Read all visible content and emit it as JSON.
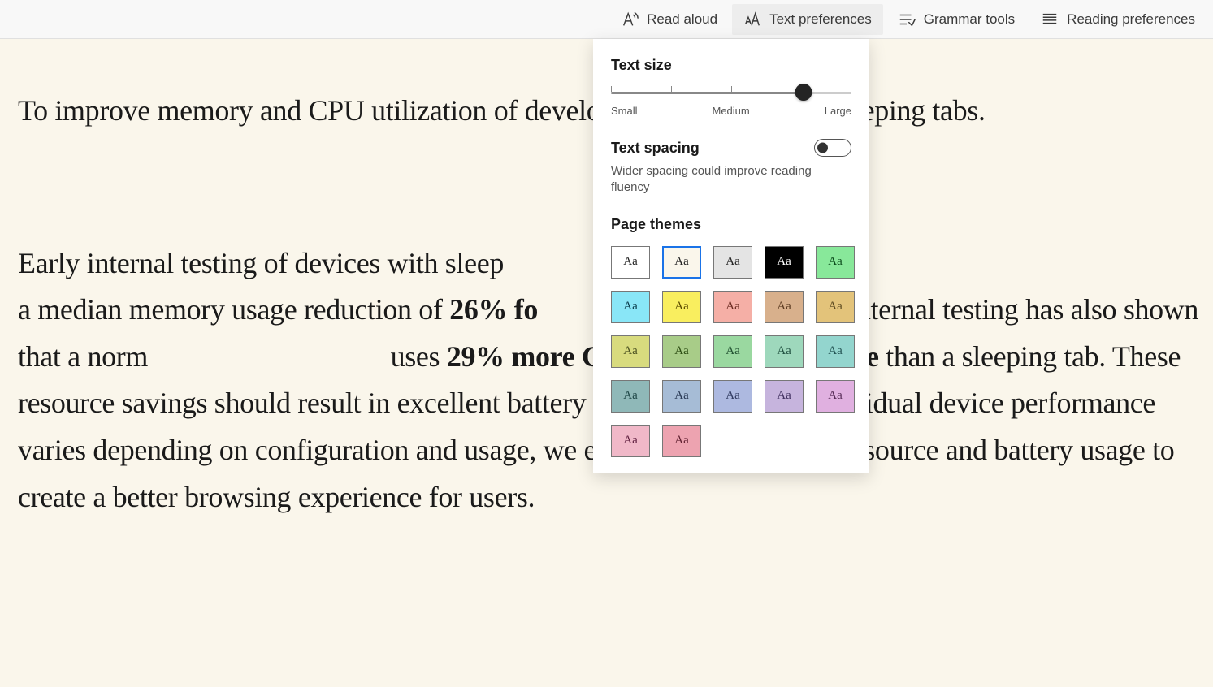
{
  "toolbar": {
    "read_aloud": "Read aloud",
    "text_preferences": "Text preferences",
    "grammar_tools": "Grammar tools",
    "reading_preferences": "Reading preferences"
  },
  "article": {
    "p1": "To improve memory and CPU utilization of developed a feature called sleeping tabs.",
    "p2_a": "Early internal testing of devices with sleep",
    "p2_b": "a median memory usage reduction of ",
    "p2_bold1": "26% fo",
    "p2_c": "Our internal testing has also shown that a norm",
    "p2_d": "uses ",
    "p2_bold2": "29% more CPU for Microsoft Edge",
    "p2_e": " than a sleeping tab. These resource savings should result in excellent battery savings. Although individual device performance varies depending on configuration and usage, we expect the decrease in resource and battery usage to create a better browsing experience for users."
  },
  "panel": {
    "text_size": {
      "title": "Text size",
      "small": "Small",
      "medium": "Medium",
      "large": "Large"
    },
    "text_spacing": {
      "title": "Text spacing",
      "desc": "Wider spacing could improve reading fluency"
    },
    "page_themes": {
      "title": "Page themes",
      "sample": "Aa"
    },
    "themes": [
      {
        "bg": "#ffffff",
        "fg": "#222222",
        "selected": false
      },
      {
        "bg": "#faf6eb",
        "fg": "#222222",
        "selected": true
      },
      {
        "bg": "#e4e4e4",
        "fg": "#222222",
        "selected": false
      },
      {
        "bg": "#000000",
        "fg": "#ffffff",
        "selected": false
      },
      {
        "bg": "#88e89a",
        "fg": "#0a4a1a",
        "selected": false
      },
      {
        "bg": "#89e6f7",
        "fg": "#0a3a4a",
        "selected": false
      },
      {
        "bg": "#f9ee5f",
        "fg": "#5a4a00",
        "selected": false
      },
      {
        "bg": "#f5afa6",
        "fg": "#6a2a20",
        "selected": false
      },
      {
        "bg": "#d8b08c",
        "fg": "#5a3a20",
        "selected": false
      },
      {
        "bg": "#e3c37a",
        "fg": "#5a4820",
        "selected": false
      },
      {
        "bg": "#d8db7e",
        "fg": "#4a5020",
        "selected": false
      },
      {
        "bg": "#a8cc88",
        "fg": "#2a4a10",
        "selected": false
      },
      {
        "bg": "#9ad8a0",
        "fg": "#205030",
        "selected": false
      },
      {
        "bg": "#9ed8bc",
        "fg": "#205040",
        "selected": false
      },
      {
        "bg": "#93d5ce",
        "fg": "#205050",
        "selected": false
      },
      {
        "bg": "#8fb8b8",
        "fg": "#204848",
        "selected": false
      },
      {
        "bg": "#a6bcd6",
        "fg": "#2a3a55",
        "selected": false
      },
      {
        "bg": "#adb9e0",
        "fg": "#303a60",
        "selected": false
      },
      {
        "bg": "#c6b4dd",
        "fg": "#403060",
        "selected": false
      },
      {
        "bg": "#e0b0e0",
        "fg": "#552a55",
        "selected": false
      },
      {
        "bg": "#f0b8c8",
        "fg": "#602040",
        "selected": false
      },
      {
        "bg": "#eda3b0",
        "fg": "#602030",
        "selected": false
      }
    ]
  }
}
